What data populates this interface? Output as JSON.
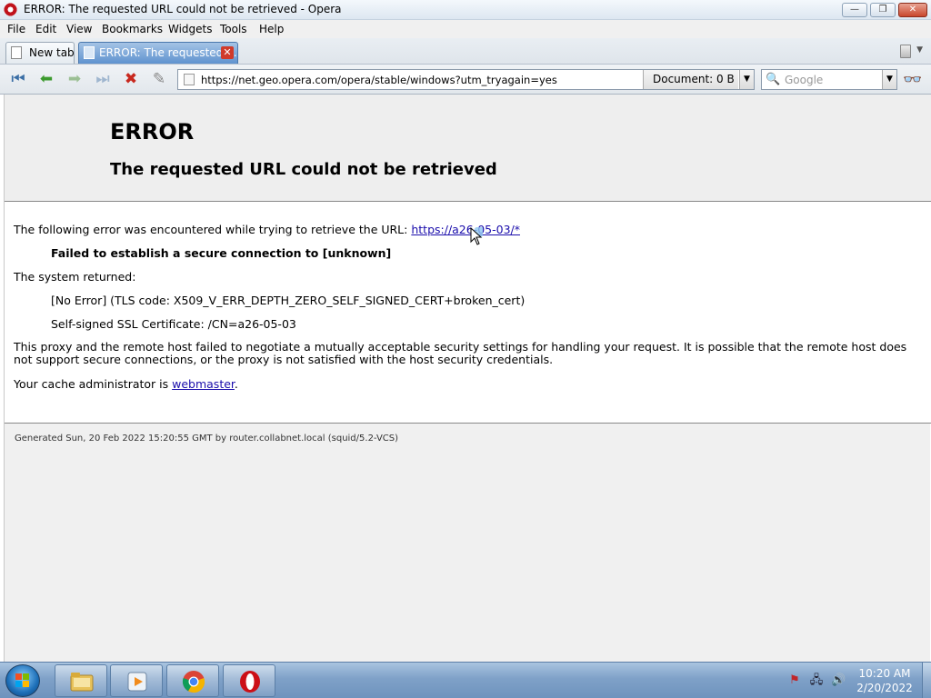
{
  "window": {
    "title": "ERROR: The requested URL could not be retrieved - Opera",
    "minimize": "—",
    "restore": "❐",
    "close": "✕"
  },
  "menu": [
    "File",
    "Edit",
    "View",
    "Bookmarks",
    "Widgets",
    "Tools",
    "Help"
  ],
  "tabs": [
    {
      "label": "New tab",
      "active": false
    },
    {
      "label": "ERROR: The requested ...",
      "active": true
    }
  ],
  "toolbar": {
    "address": "https://net.geo.opera.com/opera/stable/windows?utm_tryagain=yes",
    "document_status": "Document:  0 B",
    "search_placeholder": "Google"
  },
  "page": {
    "heading": "ERROR",
    "subheading": "The requested URL could not be retrieved",
    "intro": "The following error was encountered while trying to retrieve the URL: ",
    "url_link": "https://a26-05-03/*",
    "failure": "Failed to establish a secure connection to [unknown]",
    "system_returned": "The system returned:",
    "tls_code": "[No Error] (TLS code: X509_V_ERR_DEPTH_ZERO_SELF_SIGNED_CERT+broken_cert)",
    "cert": "Self-signed SSL Certificate: /CN=a26-05-03",
    "explanation": "This proxy and the remote host failed to negotiate a mutually acceptable security settings for handling your request. It is possible that the remote host does not support secure connections, or the proxy is not satisfied with the host security credentials.",
    "admin_prefix": "Your cache administrator is ",
    "admin_link": "webmaster",
    "admin_suffix": ".",
    "footer": "Generated Sun, 20 Feb 2022 15:20:55 GMT by router.collabnet.local (squid/5.2-VCS)"
  },
  "taskbar": {
    "time": "10:20 AM",
    "date": "2/20/2022",
    "pinned": [
      "file-explorer",
      "media-player",
      "chrome",
      "opera"
    ]
  },
  "colors": {
    "link": "#1a0dab",
    "taskbar": "#7fa1c8",
    "active_tab": "#5f93cf"
  }
}
